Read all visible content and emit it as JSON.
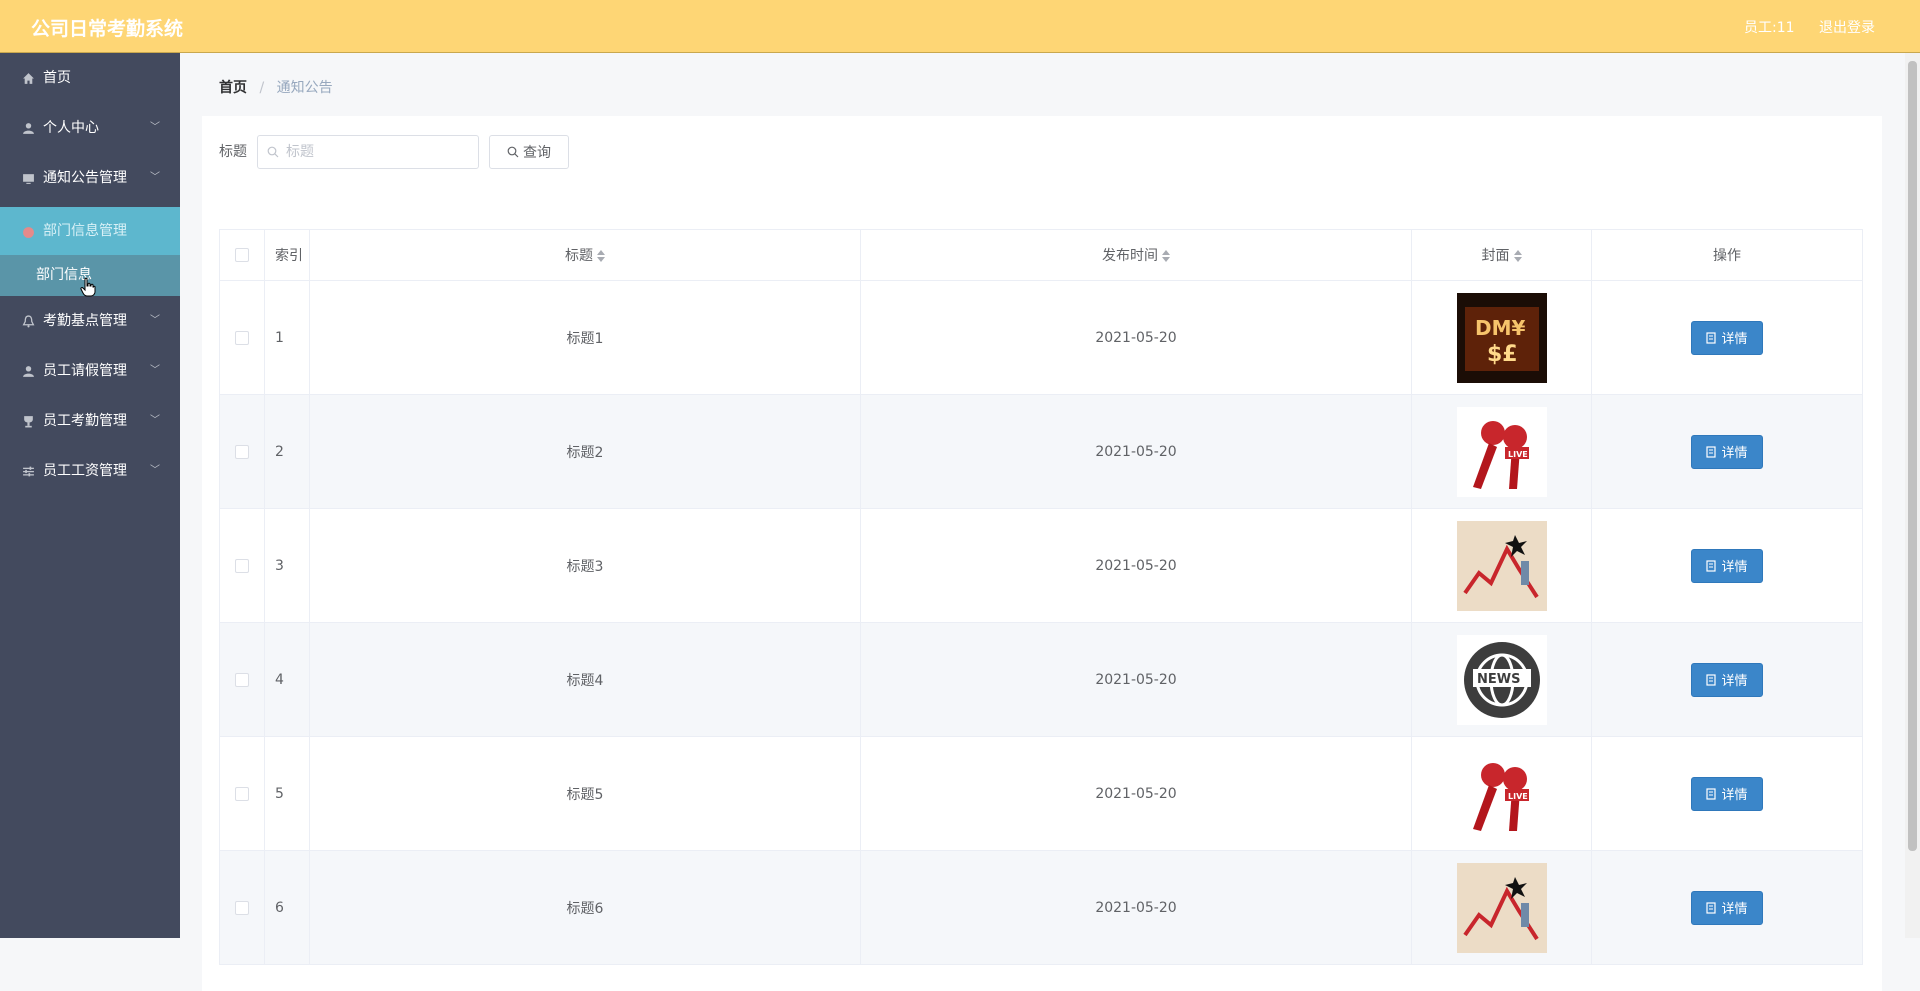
{
  "app": {
    "title": "公司日常考勤系统"
  },
  "header": {
    "user": "员工:11",
    "logout": "退出登录"
  },
  "sidebar": {
    "items": [
      {
        "label": "首页",
        "icon": "home-icon"
      },
      {
        "label": "个人中心",
        "icon": "user-icon"
      },
      {
        "label": "通知公告管理",
        "icon": "monitor-icon"
      },
      {
        "label": "部门信息管理",
        "icon": "department-icon",
        "active": true
      },
      {
        "label": "部门信息",
        "submenu": true
      },
      {
        "label": "考勤基点管理",
        "icon": "bell-icon"
      },
      {
        "label": "员工请假管理",
        "icon": "user-icon"
      },
      {
        "label": "员工考勤管理",
        "icon": "trophy-icon"
      },
      {
        "label": "员工工资管理",
        "icon": "sliders-icon"
      }
    ]
  },
  "breadcrumb": {
    "home": "首页",
    "current": "通知公告"
  },
  "search": {
    "label": "标题",
    "placeholder": "标题",
    "button": "查询"
  },
  "table": {
    "headers": {
      "index": "索引",
      "title": "标题",
      "time": "发布时间",
      "cover": "封面",
      "action": "操作"
    },
    "rows": [
      {
        "index": "1",
        "title": "标题1",
        "time": "2021-05-20",
        "cover": "money-symbols-image",
        "action": "详情"
      },
      {
        "index": "2",
        "title": "标题2",
        "time": "2021-05-20",
        "cover": "live-microphone-image",
        "action": "详情"
      },
      {
        "index": "3",
        "title": "标题3",
        "time": "2021-05-20",
        "cover": "stock-chart-image",
        "action": "详情"
      },
      {
        "index": "4",
        "title": "标题4",
        "time": "2021-05-20",
        "cover": "news-globe-image",
        "action": "详情"
      },
      {
        "index": "5",
        "title": "标题5",
        "time": "2021-05-20",
        "cover": "live-microphone-image",
        "action": "详情"
      },
      {
        "index": "6",
        "title": "标题6",
        "time": "2021-05-20",
        "cover": "stock-chart-image",
        "action": "详情"
      }
    ]
  },
  "colors": {
    "header": "#fed675",
    "sidebar": "#434a5e",
    "sidebar_active": "#5db7ce",
    "primary_button": "#3b86c9"
  }
}
